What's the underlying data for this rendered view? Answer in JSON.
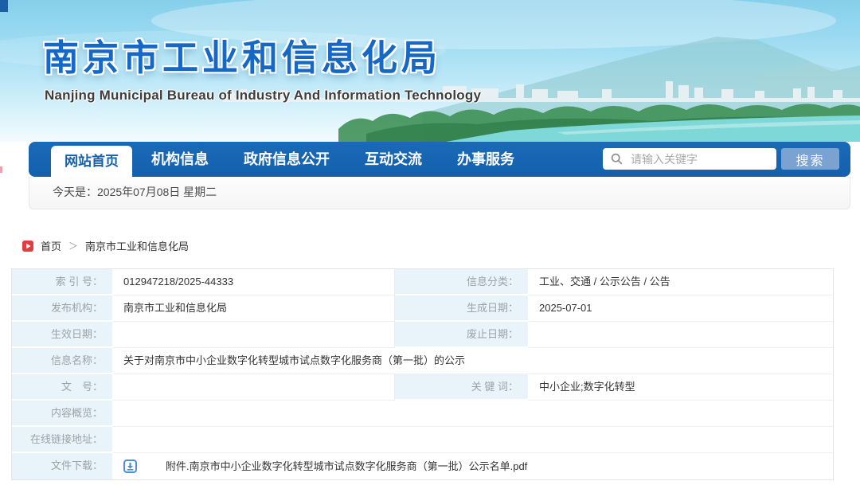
{
  "banner": {
    "title": "南京市工业和信息化局",
    "subtitle": "Nanjing Municipal Bureau of Industry And Information Technology"
  },
  "nav": {
    "active_tab": "网站首页",
    "items": [
      "机构信息",
      "政府信息公开",
      "互动交流",
      "办事服务"
    ],
    "search_placeholder": "请输入关键字",
    "search_button": "搜索"
  },
  "date_bar": {
    "text": "今天是：2025年07月08日  星期二"
  },
  "breadcrumb": {
    "home": "首页",
    "separator": "＞",
    "current": "南京市工业和信息化局"
  },
  "colors": {
    "nav_blue": "#1661ae",
    "accent_red": "#e23c3c",
    "link_blue": "#4a8fe2",
    "label_cell": "#e9f3fa"
  },
  "table": {
    "rows": [
      {
        "l1": "索 引 号：",
        "v1": "012947218/2025-44333",
        "l2": "信息分类：",
        "v2": "工业、交通 / 公示公告 / 公告"
      },
      {
        "l1": "发布机构：",
        "v1": "南京市工业和信息化局",
        "l2": "生成日期：",
        "v2": "2025-07-01"
      },
      {
        "l1": "生效日期：",
        "v1": "",
        "l2": "废止日期：",
        "v2": ""
      },
      {
        "l1": "信息名称：",
        "v1": "关于对南京市中小企业数字化转型城市试点数字化服务商（第一批）的公示"
      },
      {
        "l1": "文　号：",
        "v1": "",
        "l2": "关 键 词：",
        "v2": "中小企业;数字化转型"
      },
      {
        "l1": "内容概览：",
        "v1": ""
      },
      {
        "l1": "在线链接地址：",
        "v1": ""
      },
      {
        "l1": "文件下载：",
        "attachment": "附件.南京市中小企业数字化转型城市试点数字化服务商（第一批）公示名单.pdf"
      }
    ]
  }
}
